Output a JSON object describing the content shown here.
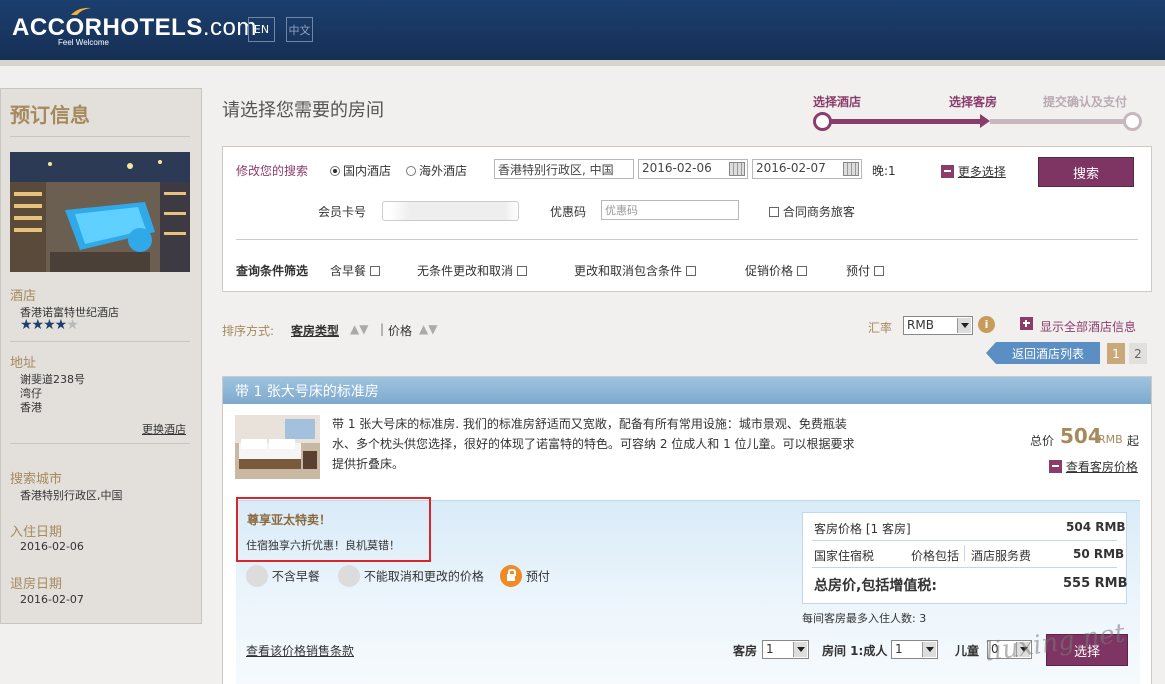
{
  "header": {
    "logo_bold": "ACCOR",
    "logo_rest": "HOTELS",
    "logo_suffix": ".com",
    "tagline": "Feel Welcome",
    "lang_en": "EN",
    "lang_zh": "中文"
  },
  "sidebar": {
    "title": "预订信息",
    "hotel_label": "酒店",
    "hotel_name": "香港诺富特世纪酒店",
    "stars_on": "★★★★",
    "stars_off": "★",
    "star_rating": 4,
    "address_label": "地址",
    "address_line1": "谢斐道238号",
    "address_line2": "湾仔",
    "address_line3": "香港",
    "change_hotel": "更换酒店",
    "city_label": "搜索城市",
    "city_value": "香港特别行政区,中国",
    "checkin_label": "入住日期",
    "checkin_value": "2016-02-06",
    "checkout_label": "退房日期",
    "checkout_value": "2016-02-07"
  },
  "page_title": "请选择您需要的房间",
  "progress": {
    "step1": "选择酒店",
    "step2": "选择客房",
    "step3": "提交确认及支付"
  },
  "search": {
    "modify_label": "修改您的搜索",
    "radio_domestic": "国内酒店",
    "radio_overseas": "海外酒店",
    "destination": "香港特别行政区, 中国",
    "checkin": "2016-02-06",
    "checkout": "2016-02-07",
    "nights": "晚:1",
    "more_options": "更多选择",
    "search_button": "搜索",
    "member_label": "会员卡号",
    "promo_label": "优惠码",
    "promo_placeholder": "优惠码",
    "corporate_label": "合同商务旅客",
    "filter_label": "查询条件筛选",
    "filter_breakfast": "含早餐",
    "filter_free_cancel": "无条件更改和取消",
    "filter_conditional": "更改和取消包含条件",
    "filter_promo": "促销价格",
    "filter_prepay": "预付"
  },
  "sort": {
    "label": "排序方式:",
    "by_room": "客房类型",
    "separator": "|",
    "by_price": "价格",
    "rate_label": "汇率",
    "currency": "RMB",
    "show_all": "显示全部酒店信息",
    "back_to_list": "返回酒店列表",
    "page1": "1",
    "page2": "2"
  },
  "room": {
    "title": "带 1 张大号床的标准房",
    "description": "带 1 张大号床的标准房. 我们的标准房舒适而又宽敞，配备有所有常用设施：城市景观、免费瓶装水、多个枕头供您选择，很好的体现了诺富特的特色。可容纳 2 位成人和 1 位儿童。可以根据要求提供折叠床。",
    "total_label": "总价",
    "total_price": "504",
    "total_currency": "RMB",
    "total_suffix": "起",
    "view_prices": "查看客房价格",
    "promo_title": "尊享亚太特卖！",
    "promo_sub": "住宿独享六折优惠！良机莫错！",
    "amen_breakfast": "不含早餐",
    "amen_cancel": "不能取消和更改的价格",
    "amen_prepay": "预付",
    "price_room_label": "客房价格 [1 客房]",
    "price_room_value": "504 RMB",
    "tax_label": "国家住宿税",
    "tax_included": "价格包括",
    "service_label": "酒店服务费",
    "service_value": "50 RMB",
    "grand_label": "总房价,包括增值税:",
    "grand_value": "555 RMB",
    "max_guests": "每间客房最多入住人数: 3",
    "sales_terms": "查看该价格销售条款",
    "rooms_label": "客房",
    "rooms_value": "1",
    "adults_label": "房间 1:成人",
    "adults_value": "1",
    "children_label": "儿童",
    "children_value": "0",
    "select_button": "选择"
  },
  "watermark": "liuxing.net"
}
